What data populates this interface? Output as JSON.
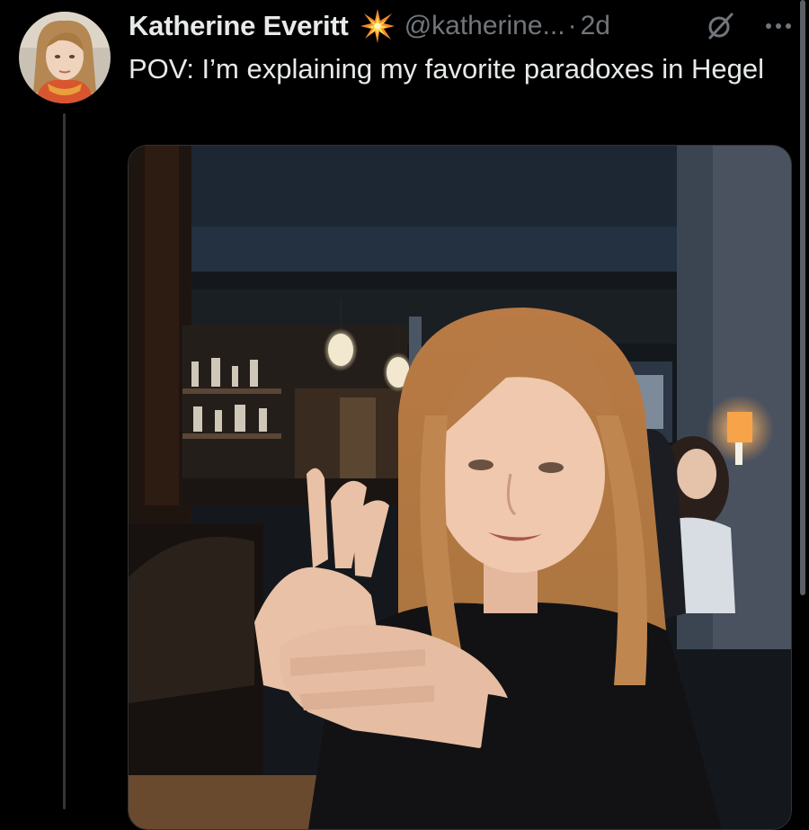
{
  "post": {
    "author_name": "Katherine Everitt",
    "handle": "@katherine...",
    "separator": "·",
    "time": "2d",
    "text": "POV: I’m explaining my favorite paradoxes in Hegel"
  },
  "icons": {
    "badge": "sparkle-burst-icon",
    "grok": "grok-icon",
    "more": "more-options-icon"
  },
  "colors": {
    "background": "#000000",
    "primary_text": "#e7e9ea",
    "secondary_text": "#71767b",
    "thread_line": "#333639"
  }
}
